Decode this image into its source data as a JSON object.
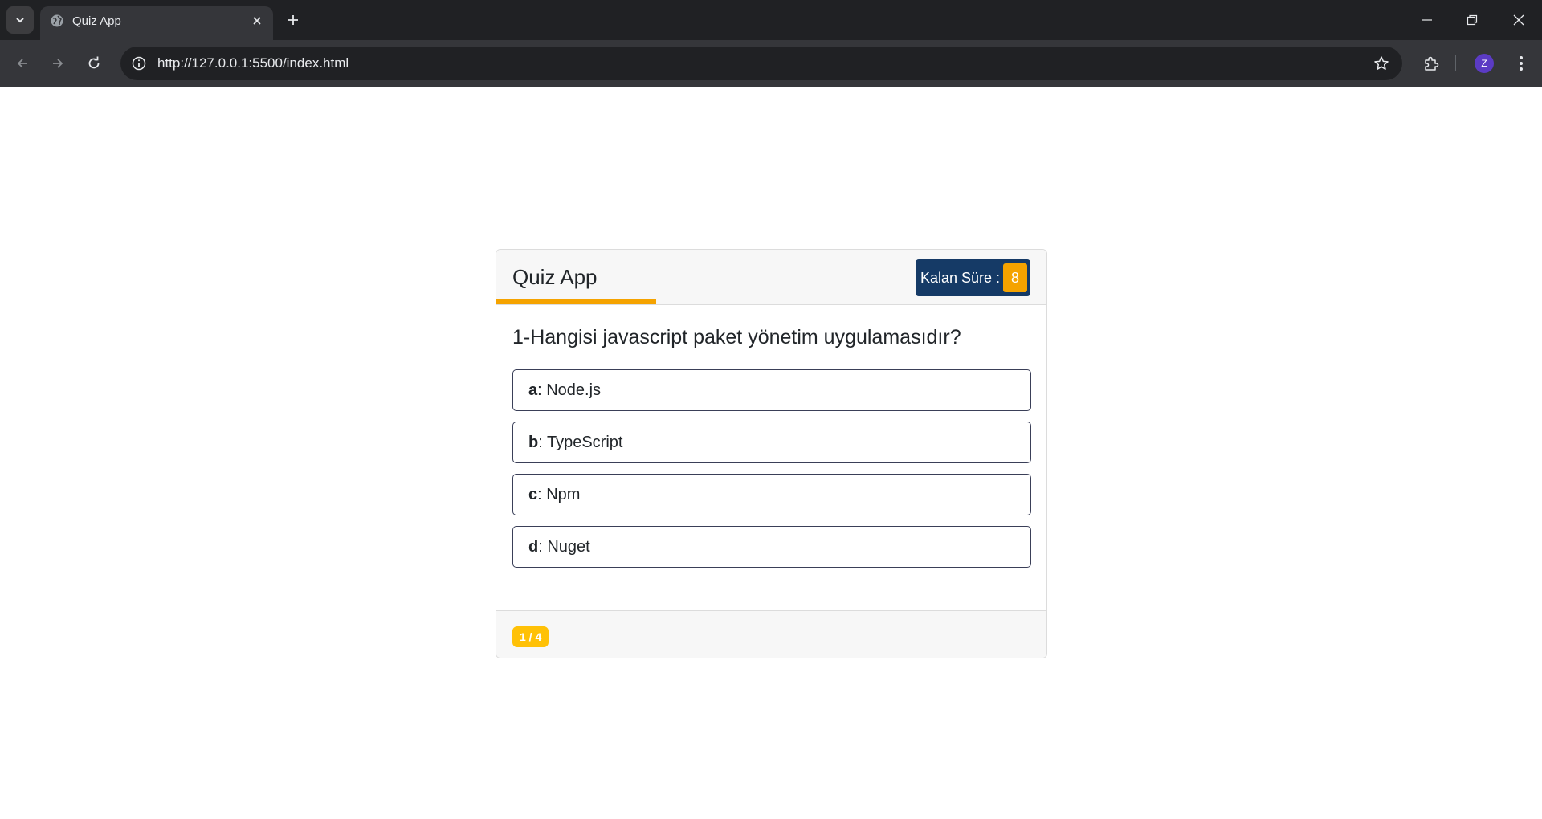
{
  "browser": {
    "tab_title": "Quiz App",
    "url": "http://127.0.0.1:5500/index.html",
    "profile_initial": "Z"
  },
  "icons": {
    "tab_menu": "chevron-down-icon",
    "favicon": "globe-icon",
    "tab_close": "close-icon",
    "new_tab": "plus-icon",
    "back": "arrow-left-icon",
    "forward": "arrow-right-icon",
    "reload": "reload-icon",
    "site_info": "info-icon",
    "bookmark": "star-icon",
    "extensions": "puzzle-icon",
    "menu": "kebab-icon"
  },
  "quiz": {
    "title": "Quiz App",
    "timer_label": "Kalan Süre :",
    "timer_value": "8",
    "question": "1-Hangisi javascript paket yönetim uygulamasıdır?",
    "options": [
      {
        "key": "a",
        "text": ": Node.js"
      },
      {
        "key": "b",
        "text": ": TypeScript"
      },
      {
        "key": "c",
        "text": ": Npm"
      },
      {
        "key": "d",
        "text": ": Nuget"
      }
    ],
    "progress": "1 / 4"
  },
  "colors": {
    "accent": "#f5a300",
    "timer_bg": "#153a66",
    "badge": "#ffc107"
  }
}
